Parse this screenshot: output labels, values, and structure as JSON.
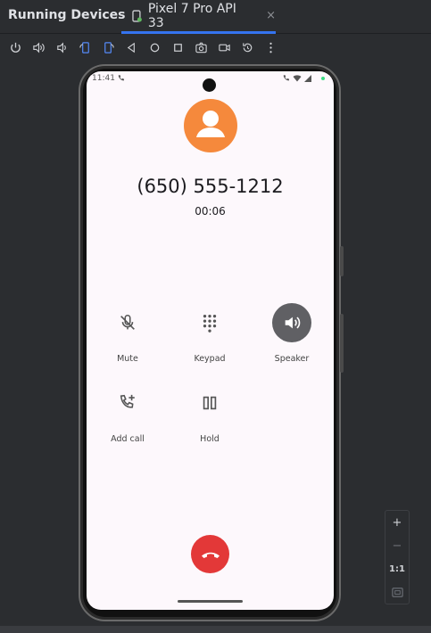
{
  "panel": {
    "title": "Running Devices",
    "device_tab": "Pixel 7 Pro API 33",
    "close_glyph": "×"
  },
  "toolbar": {
    "buttons": [
      "power-icon",
      "volume-up-icon",
      "volume-down-icon",
      "rotate-left-icon",
      "rotate-right-icon",
      "back-icon",
      "home-icon",
      "overview-icon",
      "screenshot-icon",
      "screen-record-icon",
      "reset-icon",
      "more-icon"
    ]
  },
  "status_bar": {
    "time": "11:41"
  },
  "call": {
    "number": "(650) 555-1212",
    "duration": "00:06",
    "avatar_color": "#f5893c",
    "end_color": "#e33838"
  },
  "controls": [
    {
      "label": "Mute",
      "icon": "mic-off-icon",
      "active": false
    },
    {
      "label": "Keypad",
      "icon": "dialpad-icon",
      "active": false
    },
    {
      "label": "Speaker",
      "icon": "speaker-icon",
      "active": true
    },
    {
      "label": "Add call",
      "icon": "add-call-icon",
      "active": false
    },
    {
      "label": "Hold",
      "icon": "pause-icon",
      "active": false
    }
  ],
  "zoom": {
    "in": "+",
    "out": "−",
    "actual": "1:1"
  }
}
